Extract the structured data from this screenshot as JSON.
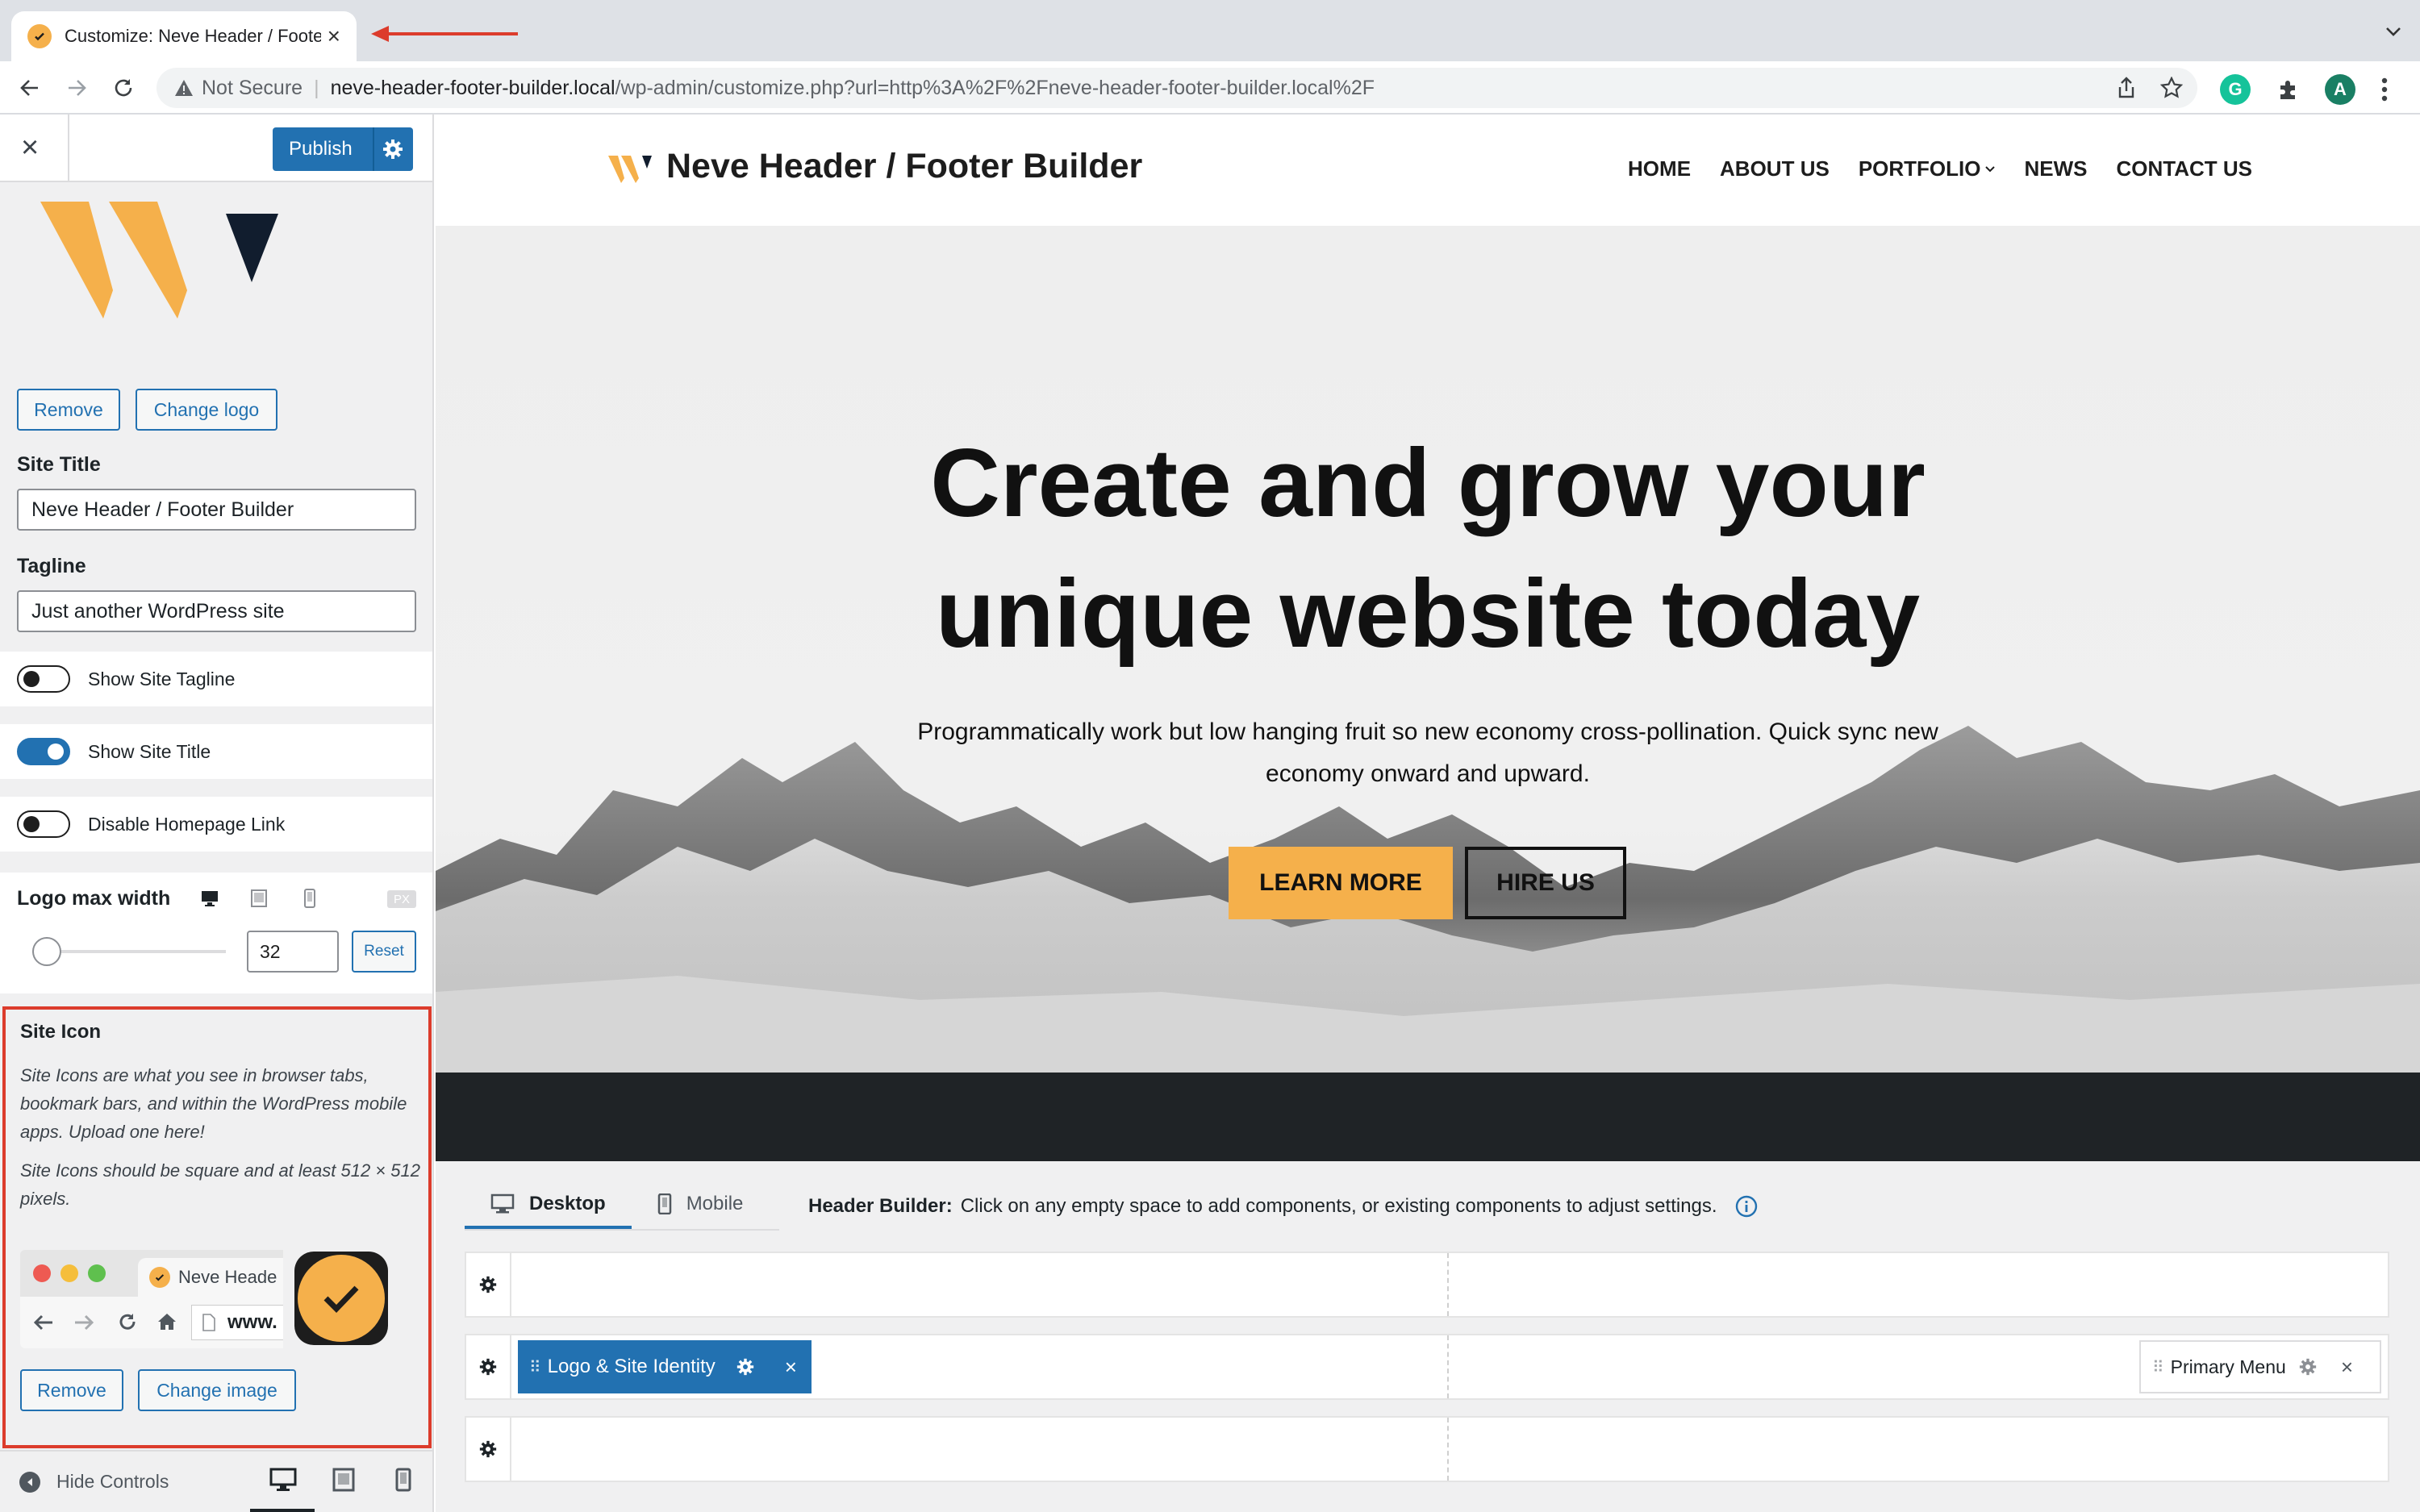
{
  "browser": {
    "tab_title": "Customize: Neve Header / Footer Builder",
    "not_secure": "Not Secure",
    "url_host": "neve-header-footer-builder.local",
    "url_path": "/wp-admin/customize.php?url=http%3A%2F%2Fneve-header-footer-builder.local%2F",
    "avatar_letter": "A",
    "extension_letter": "G"
  },
  "sidebar": {
    "publish_label": "Publish",
    "logo_remove_label": "Remove",
    "change_logo_label": "Change logo",
    "site_title_label": "Site Title",
    "site_title_value": "Neve Header / Footer Builder",
    "tagline_label": "Tagline",
    "tagline_value": "Just another WordPress site",
    "toggles": [
      {
        "label": "Show Site Tagline",
        "on": false
      },
      {
        "label": "Show Site Title",
        "on": true
      },
      {
        "label": "Disable Homepage Link",
        "on": false
      }
    ],
    "logo_max_width_label": "Logo max width",
    "unit": "PX",
    "logo_max_width_value": "32",
    "reset_label": "Reset",
    "site_icon": {
      "title": "Site Icon",
      "desc1": "Site Icons are what you see in browser tabs, bookmark bars, and within the WordPress mobile apps. Upload one here!",
      "desc2": "Site Icons should be square and at least 512 × 512 pixels.",
      "preview_tab": "Neve Heade",
      "preview_url": "www.",
      "remove_label": "Remove",
      "change_image_label": "Change image"
    },
    "hide_controls_label": "Hide Controls"
  },
  "site": {
    "brand": "Neve Header / Footer Builder",
    "menu": [
      "HOME",
      "ABOUT US",
      "PORTFOLIO",
      "NEWS",
      "CONTACT US"
    ],
    "hero_title_line1": "Create and grow your",
    "hero_title_line2": "unique website today",
    "hero_sub": "Programmatically work but low hanging fruit so new economy cross-pollination. Quick sync new economy onward and upward.",
    "learn_more": "LEARN MORE",
    "hire_us": "HIRE US"
  },
  "builder": {
    "tab_desktop": "Desktop",
    "tab_mobile": "Mobile",
    "info_bold": "Header Builder:",
    "info_text": "Click on any empty space to add components, or existing components to adjust settings.",
    "logo_chip": "Logo & Site Identity",
    "menu_chip": "Primary Menu"
  },
  "colors": {
    "wp_blue": "#2271b1",
    "accent_orange": "#f5b04b",
    "highlight_red": "#dc3c2c"
  }
}
